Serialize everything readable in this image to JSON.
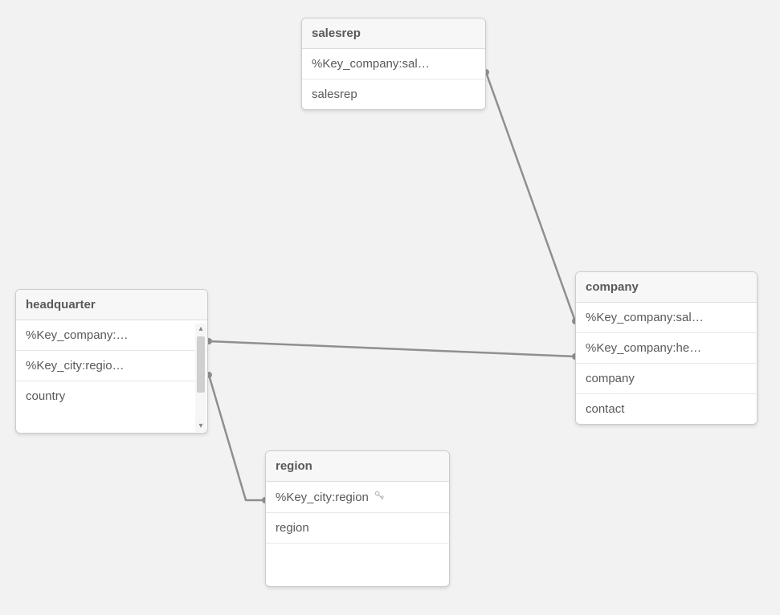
{
  "tables": {
    "salesrep": {
      "title": "salesrep",
      "fields": [
        "%Key_company:sal…",
        "salesrep"
      ]
    },
    "company": {
      "title": "company",
      "fields": [
        "%Key_company:sal…",
        "%Key_company:he…",
        "company",
        "contact"
      ]
    },
    "headquarter": {
      "title": "headquarter",
      "fields": [
        "%Key_company:…",
        "%Key_city:regio…",
        "country"
      ]
    },
    "region": {
      "title": "region",
      "fields": [
        "%Key_city:region",
        "region"
      ]
    }
  },
  "connections": [
    {
      "from": "salesrep.%Key_company:sal…",
      "to": "company.%Key_company:sal…"
    },
    {
      "from": "headquarter.%Key_company:…",
      "to": "company.%Key_company:he…"
    },
    {
      "from": "headquarter.%Key_city:regio…",
      "to": "region.%Key_city:region"
    }
  ]
}
